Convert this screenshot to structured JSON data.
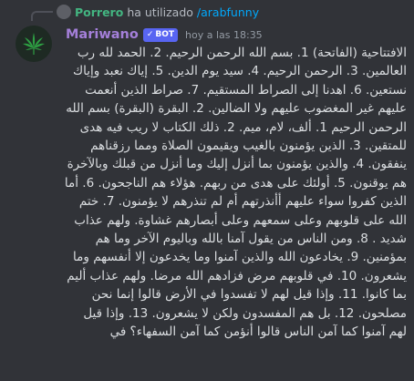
{
  "reply": {
    "username": "Porrero",
    "action_text": "ha utilizado",
    "command": "/arabfunny"
  },
  "message": {
    "author": "Mariwano",
    "badge": "BOT",
    "badge_check": "✓",
    "timestamp": "hoy a las 18:35",
    "body": "الافتتاحية (الفاتحة) 1. بسم الله الرحمن الرحيم. 2. الحمد لله رب العالمين. 3. الرحمن الرحيم. 4. سيد يوم الدين. 5. إياك نعبد وإياك نستعين. 6. اهدنا إلى الصراط المستقيم. 7. صراط الذين أنعمت عليهم غير المغضوب عليهم ولا الضالين. 2. البقرة (البقرة) بسم الله الرحمن الرحيم 1. ألف، لام، ميم. 2. ذلك الكتاب لا ريب فيه هدى للمتقين. 3. الذين يؤمنون بالغيب ويقيمون الصلاة ومما رزقناهم ينفقون. 4. والذين يؤمنون بما أنزل إليك وما أنزل من قبلك وبالآخرة هم يوقنون. 5. أولئك على هدى من ربهم. هؤلاء هم الناجحون. 6. أما الذين كفروا سواء عليهم أأنذرتهم أم لم تنذرهم لا يؤمنون. 7. ختم الله على قلوبهم وعلى سمعهم وعلى أبصارهم غشاوة. ولهم عذاب شديد . 8. ومن الناس من يقول آمنا بالله وباليوم الآخر وما هم بمؤمنين. 9. يخادعون الله والذين آمنوا وما يخدعون إلا أنفسهم وما يشعرون. 10. في قلوبهم مرض فزادهم الله مرضا. ولهم عذاب أليم بما كانوا. 11. وإذا قيل لهم لا تفسدوا في الأرض قالوا إنما نحن مصلحون. 12. بل هم المفسدون ولكن لا يشعرون. 13. وإذا قيل لهم آمنوا كما آمن الناس قالوا أنؤمن كما آمن السفهاء؟ في"
  },
  "colors": {
    "background": "#313338",
    "author": "#a47fd9",
    "reply_user": "#43b581",
    "command": "#00a8fc",
    "badge": "#5865f2",
    "text": "#dbdee1",
    "timestamp": "#949ba4"
  },
  "icons": {
    "avatar": "cannabis-leaf-icon",
    "reply_avatar": "user-avatar-icon",
    "badge_check": "check-icon"
  }
}
